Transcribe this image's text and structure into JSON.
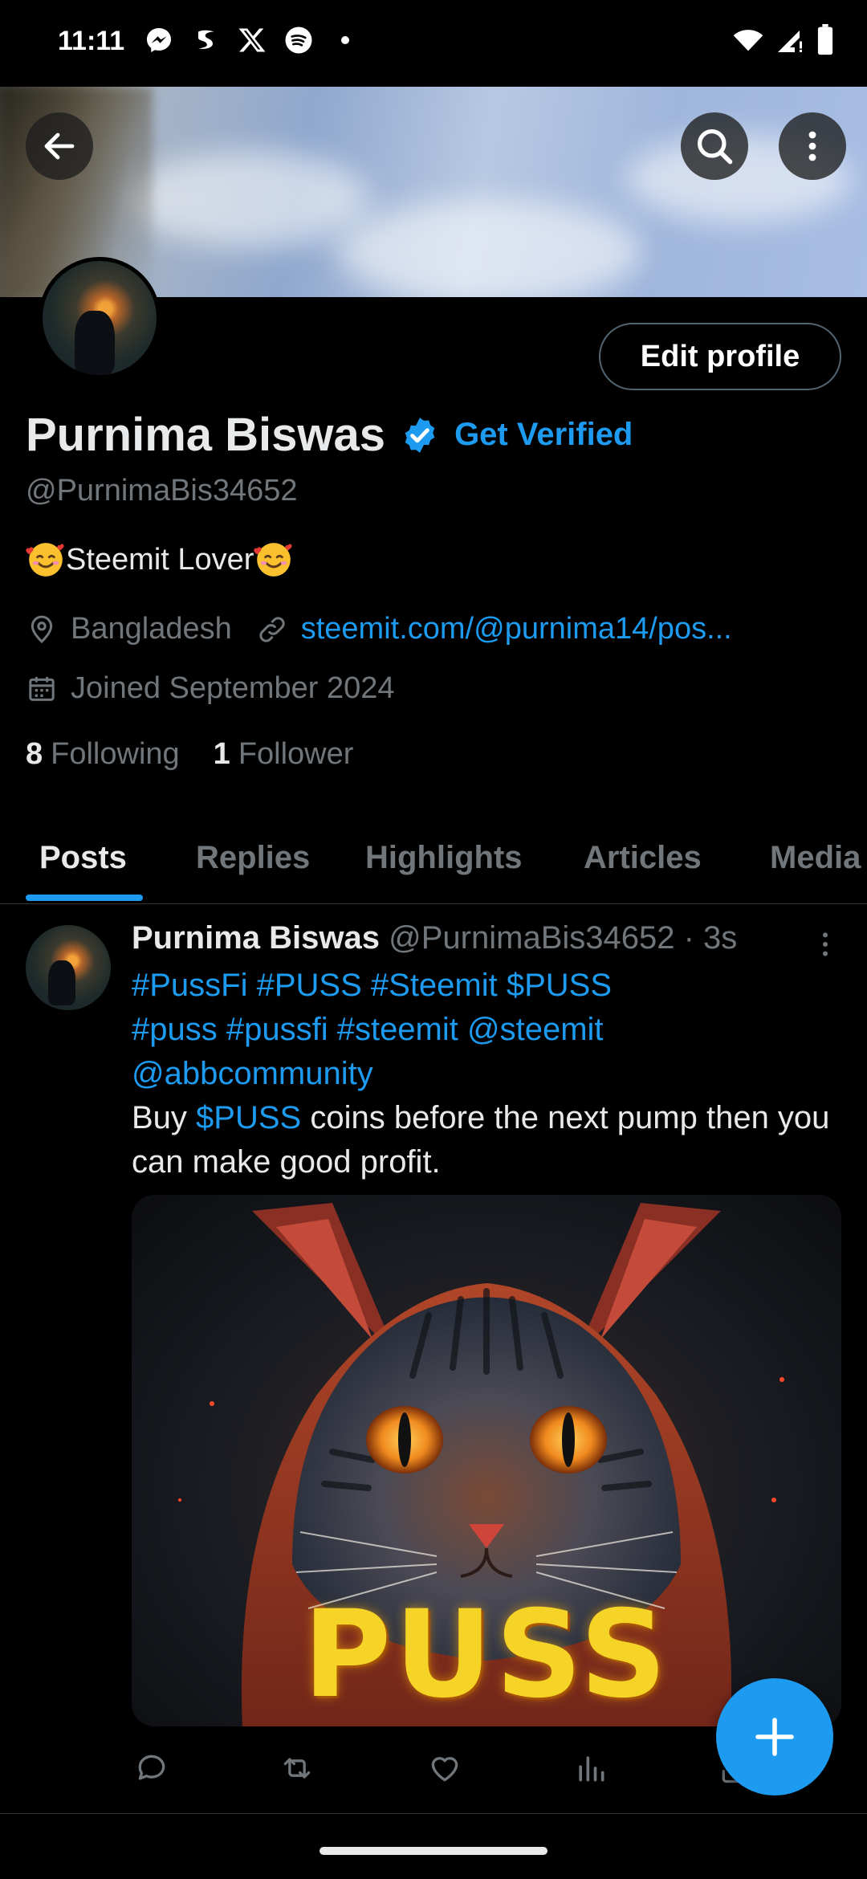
{
  "status_bar": {
    "time": "11:11",
    "left_icons": [
      "messenger-icon",
      "steemit-icon",
      "x-icon",
      "spotify-icon",
      "dot-icon"
    ],
    "right_icons": [
      "wifi-icon",
      "signal-icon",
      "battery-icon"
    ]
  },
  "header": {
    "back_icon": "arrow-left-icon",
    "search_icon": "search-icon",
    "more_icon": "more-vertical-icon"
  },
  "profile": {
    "edit_button": "Edit profile",
    "display_name": "Purnima Biswas",
    "get_verified": "Get Verified",
    "handle": "@PurnimaBis34652",
    "bio": "Steemit Lover",
    "location": "Bangladesh",
    "website": "steemit.com/@purnima14/pos...",
    "joined": "Joined September 2024",
    "following_count": "8",
    "following_label": "Following",
    "followers_count": "1",
    "followers_label": "Follower"
  },
  "tabs": [
    {
      "label": "Posts"
    },
    {
      "label": "Replies"
    },
    {
      "label": "Highlights"
    },
    {
      "label": "Articles"
    },
    {
      "label": "Media"
    }
  ],
  "post": {
    "name": "Purnima Biswas",
    "handle": "@PurnimaBis34652",
    "separator": " · ",
    "time": "3s",
    "line1": "#PussFi #PUSS #Steemit $PUSS",
    "line2": "#puss #pussfi #steemit @steemit",
    "line3": "@abbcommunity",
    "buy_prefix": "Buy ",
    "buy_cashtag": "$PUSS",
    "buy_suffix": " coins before the next pump then you can make good profit.",
    "image_text": "PUSS"
  },
  "colors": {
    "accent": "#1d9bf0",
    "background": "#000000",
    "secondary_text": "#71767b",
    "primary_text": "#e7e9ea"
  }
}
